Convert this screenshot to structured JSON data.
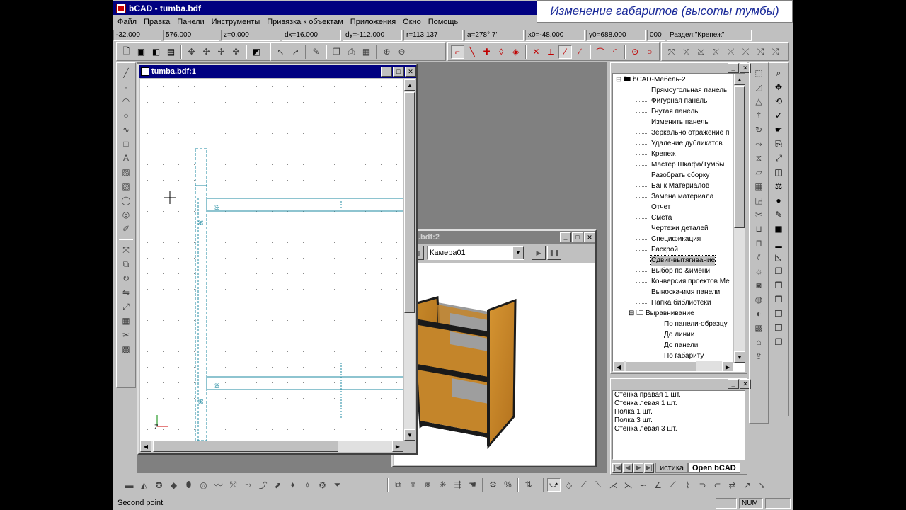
{
  "app": {
    "title": "bCAD - tumba.bdf",
    "banner": "Изменение габаритов (высоты тумбы)"
  },
  "menu": [
    "Файл",
    "Правка",
    "Панели",
    "Инструменты",
    "Привязка к объектам",
    "Приложения",
    "Окно",
    "Помощь"
  ],
  "coords": [
    {
      "label": "-32.000",
      "w": 68
    },
    {
      "label": "576.000",
      "w": 80
    },
    {
      "label": "z=0.000",
      "w": 84
    },
    {
      "label": "dx=16.000",
      "w": 84
    },
    {
      "label": "dy=-112.000",
      "w": 84
    },
    {
      "label": "r=113.137",
      "w": 84
    },
    {
      "label": "a=278° 7'",
      "w": 84
    },
    {
      "label": "x0=-48.000",
      "w": 84
    },
    {
      "label": "y0=688.000",
      "w": 84
    },
    {
      "label": "000",
      "w": 26
    },
    {
      "label": "Раздел:\"Крепеж\"",
      "w": 120
    }
  ],
  "win1": {
    "title": "tumba.bdf:1",
    "axis_label": "Z"
  },
  "win2": {
    "title": "tumba.bdf:2",
    "camera": "Камера01"
  },
  "tree": {
    "root": "bCAD-Мебель-2",
    "items": [
      "Прямоугольная панель",
      "Фигурная панель",
      "Гнутая панель",
      "Изменить панель",
      "Зеркально отражение п",
      "Удаление дубликатов",
      "Крепеж",
      "Мастер Шкафа/Тумбы",
      "Разобрать сборку",
      "Банк Материалов",
      "Замена материала",
      "Отчет",
      "Смета",
      "Чертежи деталей",
      "Спецификация",
      "Раскрой",
      "Сдвиг-вытягивание",
      "Выбор по &имени",
      "Конверсия проектов Ме",
      "Выноска-имя панели",
      "Папка библиотеки"
    ],
    "selected_index": 16,
    "folder": "Выравнивание",
    "subitems": [
      "По панели-образцу",
      "До линии",
      "До панели",
      "По габариту"
    ]
  },
  "list": {
    "items": [
      "Стенка правая 1 шт.",
      "Стенка левая 1 шт.",
      "Полка 1 шт.",
      "Полка 3 шт.",
      "Стенка левая 3 шт."
    ],
    "tabs": [
      "истика",
      "Open bCAD"
    ]
  },
  "status": {
    "text": "Second point",
    "num": "NUM"
  }
}
